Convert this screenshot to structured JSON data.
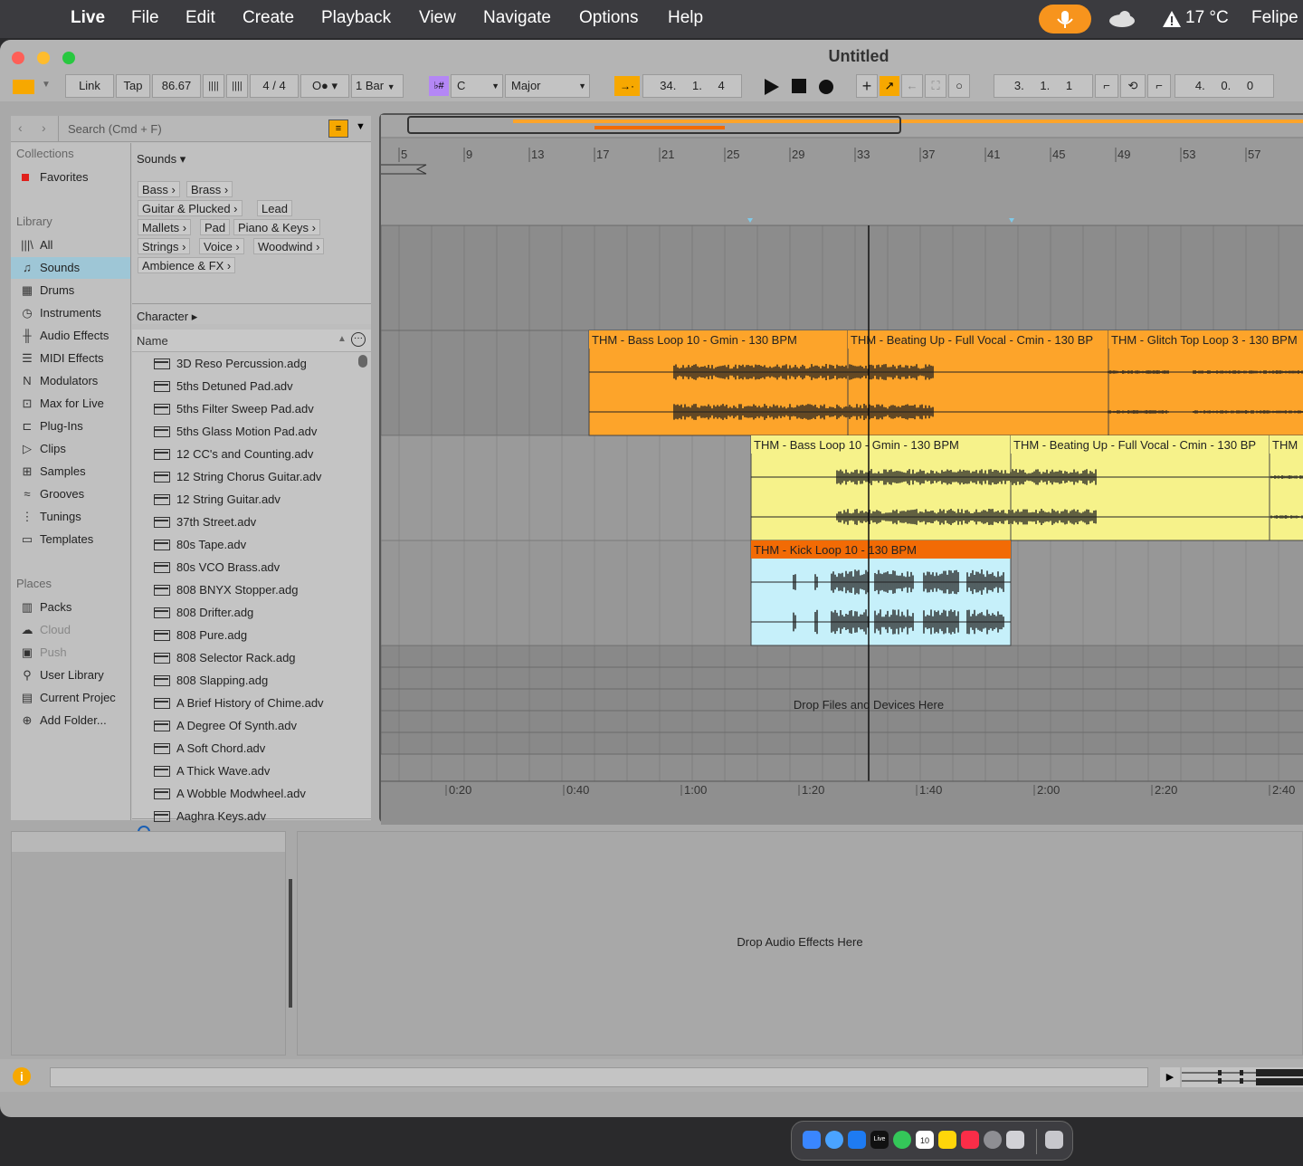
{
  "menubar": {
    "app": "Live",
    "items": [
      "File",
      "Edit",
      "Create",
      "Playback",
      "View",
      "Navigate",
      "Options",
      "Help"
    ],
    "temperature": "17 °C",
    "user": "Felipe"
  },
  "window": {
    "title": "Untitled"
  },
  "control_bar": {
    "link": "Link",
    "tap": "Tap",
    "tempo": "86.67",
    "signature_num": "4",
    "signature_sep": "/",
    "signature_den": "4",
    "quantize": "1 Bar",
    "key_root": "C",
    "scale": "Major",
    "position": [
      "34",
      "1",
      "4"
    ],
    "loop_start": [
      "3",
      "1",
      "1"
    ],
    "loop_length": [
      "4",
      "0",
      "0"
    ]
  },
  "browser": {
    "search_placeholder": "Search (Cmd + F)",
    "collections_header": "Collections",
    "favorites": "Favorites",
    "library_header": "Library",
    "library_items": [
      {
        "label": "All",
        "icon": "all-icon"
      },
      {
        "label": "Sounds",
        "icon": "sounds-icon"
      },
      {
        "label": "Drums",
        "icon": "drums-icon"
      },
      {
        "label": "Instruments",
        "icon": "instruments-icon"
      },
      {
        "label": "Audio Effects",
        "icon": "audio-effects-icon"
      },
      {
        "label": "MIDI Effects",
        "icon": "midi-effects-icon"
      },
      {
        "label": "Modulators",
        "icon": "modulators-icon"
      },
      {
        "label": "Max for Live",
        "icon": "max-for-live-icon"
      },
      {
        "label": "Plug-Ins",
        "icon": "plugins-icon"
      },
      {
        "label": "Clips",
        "icon": "clips-icon"
      },
      {
        "label": "Samples",
        "icon": "samples-icon"
      },
      {
        "label": "Grooves",
        "icon": "grooves-icon"
      },
      {
        "label": "Tunings",
        "icon": "tunings-icon"
      },
      {
        "label": "Templates",
        "icon": "templates-icon"
      }
    ],
    "places_header": "Places",
    "places_items": [
      {
        "label": "Packs",
        "icon": "packs-icon"
      },
      {
        "label": "Cloud",
        "icon": "cloud-icon"
      },
      {
        "label": "Push",
        "icon": "push-icon"
      },
      {
        "label": "User Library",
        "icon": "user-library-icon"
      },
      {
        "label": "Current Projec",
        "icon": "current-project-icon"
      },
      {
        "label": "Add Folder...",
        "icon": "add-folder-icon"
      }
    ],
    "sounds_header": "Sounds ▾",
    "tags": [
      "Bass ›",
      "Brass ›",
      "Guitar & Plucked ›",
      "Lead",
      "Mallets ›",
      "Pad",
      "Piano & Keys ›",
      "Strings ›",
      "Voice ›",
      "Woodwind ›",
      "Ambience & FX ›"
    ],
    "character": "Character ▸",
    "name_column": "Name",
    "files": [
      "3D Reso Percussion.adg",
      "5ths Detuned Pad.adv",
      "5ths Filter Sweep Pad.adv",
      "5ths Glass Motion Pad.adv",
      "12 CC's and Counting.adv",
      "12 String Chorus Guitar.adv",
      "12 String Guitar.adv",
      "37th Street.adv",
      "80s Tape.adv",
      "80s VCO Brass.adv",
      "808 BNYX Stopper.adg",
      "808 Drifter.adg",
      "808 Pure.adg",
      "808 Selector Rack.adg",
      "808 Slapping.adg",
      "A Brief History of Chime.adv",
      "A Degree Of Synth.adv",
      "A Soft Chord.adv",
      "A Thick Wave.adv",
      "A Wobble Modwheel.adv",
      "Aaghra Keys.adv"
    ]
  },
  "arrangement": {
    "bar_numbers": [
      "5",
      "9",
      "13",
      "17",
      "21",
      "25",
      "29",
      "33",
      "37",
      "41",
      "45",
      "49",
      "53",
      "57"
    ],
    "time_labels": [
      "0:20",
      "0:40",
      "1:00",
      "1:20",
      "1:40",
      "2:00",
      "2:20",
      "2:40"
    ],
    "track1_clips": [
      "THM - Bass Loop 10 - Gmin - 130 BPM",
      "THM - Beating Up - Full Vocal - Cmin - 130 BP",
      "THM - Glitch Top Loop 3 - 130 BPM"
    ],
    "track2_clips": [
      "THM - Bass Loop 10 - Gmin - 130 BPM",
      "THM - Beating Up - Full Vocal - Cmin - 130 BP",
      "THM"
    ],
    "track3_clips": [
      "THM - Kick Loop 10 - 130 BPM"
    ],
    "drop_text": "Drop Files and Devices Here",
    "colors": {
      "orange": "#fda42a",
      "yellow": "#f6f28a",
      "kick_header": "#f26b05",
      "kick_body": "#c6f0fa"
    }
  },
  "detail": {
    "drop_text": "Drop Audio Effects Here"
  }
}
